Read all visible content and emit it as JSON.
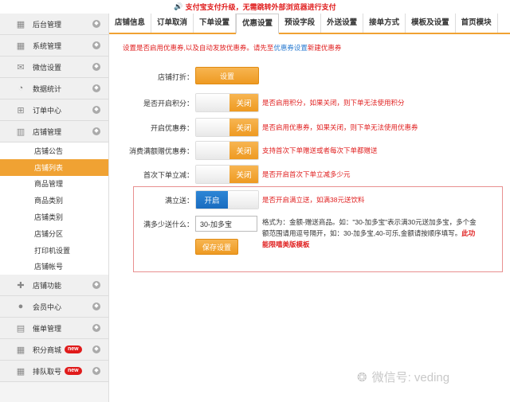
{
  "notice": {
    "icon": "speaker-icon",
    "text": "支付宝支付升级，无需跳转外部浏览器进行支付"
  },
  "sidebar": {
    "items_top": [
      {
        "label": "后台管理",
        "icon": "grid-icon"
      },
      {
        "label": "系统管理",
        "icon": "grid-icon"
      },
      {
        "label": "微信设置",
        "icon": "envelope-icon"
      },
      {
        "label": "数据统计",
        "icon": "pie-chart-icon"
      },
      {
        "label": "订单中心",
        "icon": "cart-icon"
      },
      {
        "label": "店铺管理",
        "icon": "shop-icon"
      }
    ],
    "sub_items": [
      {
        "label": "店铺公告",
        "active": false
      },
      {
        "label": "店铺列表",
        "active": true
      },
      {
        "label": "商品管理",
        "active": false
      },
      {
        "label": "商品类别",
        "active": false
      },
      {
        "label": "店铺类别",
        "active": false
      },
      {
        "label": "店铺分区",
        "active": false
      },
      {
        "label": "打印机设置",
        "active": false
      },
      {
        "label": "店铺帐号",
        "active": false
      }
    ],
    "items_bottom": [
      {
        "label": "店铺功能",
        "icon": "plus-icon",
        "badge": ""
      },
      {
        "label": "会员中心",
        "icon": "user-icon",
        "badge": ""
      },
      {
        "label": "催单管理",
        "icon": "printer-icon",
        "badge": ""
      },
      {
        "label": "积分商城",
        "icon": "grid-icon",
        "badge": "new"
      },
      {
        "label": "排队取号",
        "icon": "grid-icon",
        "badge": "new"
      }
    ]
  },
  "tabs": [
    "店铺信息",
    "订单取消",
    "下单设置",
    "优惠设置",
    "预设字段",
    "外送设置",
    "接单方式",
    "模板及设置",
    "首页模块"
  ],
  "active_tab": "优惠设置",
  "hint": {
    "text": "设置是否启用优惠券,以及自动发放优惠券。请先至",
    "link": "优惠券设置",
    "tail": "新建优惠券"
  },
  "form": {
    "discount": {
      "label": "店铺打折：",
      "button": "设置"
    },
    "points": {
      "label": "是否开启积分：",
      "toggle": "关闭",
      "desc": "是否启用积分，如果关闭，则下单无法使用积分"
    },
    "coupon": {
      "label": "开启优惠券：",
      "toggle": "关闭",
      "desc": "是否启用优惠券，如果关闭，则下单无法使用优惠券"
    },
    "full_gift": {
      "label": "消费满额赠优惠券：",
      "toggle": "关闭",
      "desc": "支持首次下单赠送或者每次下单都赠送"
    },
    "first_order": {
      "label": "首次下单立减：",
      "toggle": "关闭",
      "desc": "是否开启首次下单立减多少元"
    },
    "full_send": {
      "label": "满立送：",
      "toggle": "开启",
      "desc": "是否开启满立送，如满38元送饮料"
    },
    "how_much": {
      "label": "满多少送什么：",
      "value": "30-加多宝",
      "desc": "格式为：金额-赠送商品。如：\"30-加多宝\"表示满30元送加多宝，多个金额范围请用逗号隔开，如：30-加多宝,40-可乐,金额请按顺序填写。",
      "desc_red": "此功能限嘻美版模板"
    },
    "save_button": "保存设置"
  },
  "watermark": {
    "icon": "wechat-icon",
    "text": "微信号: veding"
  }
}
